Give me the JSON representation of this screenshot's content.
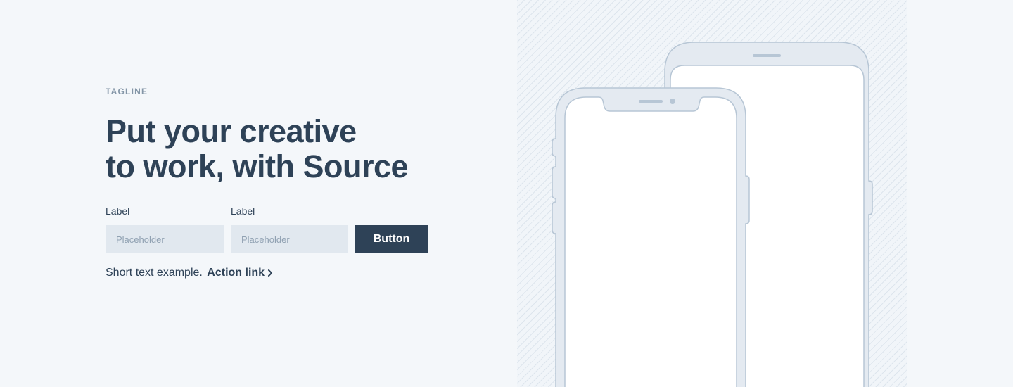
{
  "hero": {
    "tagline": "TAGLINE",
    "headline_line1": "Put your creative",
    "headline_line2": "to work, with Source"
  },
  "form": {
    "field1": {
      "label": "Label",
      "placeholder": "Placeholder"
    },
    "field2": {
      "label": "Label",
      "placeholder": "Placeholder"
    },
    "button_label": "Button"
  },
  "footer_text": {
    "text": "Short text example.",
    "link_label": "Action link",
    "link_icon": "chevron-right-icon"
  },
  "illustration": {
    "description_icons": [
      "phone-front-icon",
      "phone-back-icon"
    ]
  },
  "colors": {
    "background": "#f4f7fa",
    "primary": "#2e4257",
    "muted": "#8496a7",
    "input_bg": "#e1e8ef",
    "device_outline": "#b7c6d5"
  }
}
